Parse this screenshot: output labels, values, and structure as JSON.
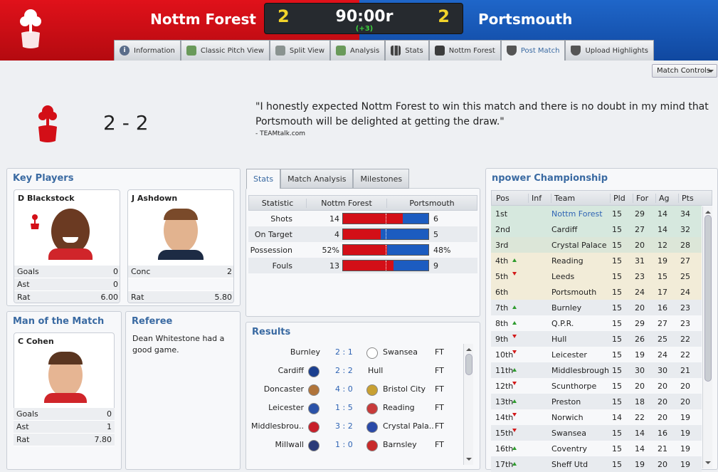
{
  "header": {
    "home_team": "Nottm Forest",
    "away_team": "Portsmouth",
    "home_score": "2",
    "away_score": "2",
    "clock": "90:00r",
    "added_time": "(+3)",
    "home_color": "#d30f17",
    "away_color": "#1c5cc0"
  },
  "tabs": [
    {
      "label": "Information",
      "icon": "info-icon"
    },
    {
      "label": "Classic Pitch View",
      "icon": "pitch-icon"
    },
    {
      "label": "Split View",
      "icon": "split-view-icon"
    },
    {
      "label": "Analysis",
      "icon": "analysis-icon"
    },
    {
      "label": "Stats",
      "icon": "bar-chart-icon"
    },
    {
      "label": "Nottm Forest",
      "icon": "tactics-board-icon"
    },
    {
      "label": "Post Match",
      "icon": "shield-icon"
    },
    {
      "label": "Upload Highlights",
      "icon": "shield-icon"
    }
  ],
  "active_tab": "Post Match",
  "match_controls_label": "Match Controls",
  "summary": {
    "final_score": "2 - 2",
    "quote": "\"I honestly expected Nottm Forest to win this match and there is no doubt in my mind that Portsmouth will be delighted at getting the draw.\"",
    "source": "- TEAMtalk.com"
  },
  "key_players": {
    "title": "Key Players",
    "players": [
      {
        "name": "D Blackstock",
        "rows": [
          {
            "label": "Goals",
            "value": "0"
          },
          {
            "label": "Ast",
            "value": "0"
          },
          {
            "label": "Rat",
            "value": "6.00"
          }
        ]
      },
      {
        "name": "J Ashdown",
        "rows": [
          {
            "label": "Conc",
            "value": "2"
          },
          {
            "label": "",
            "value": ""
          },
          {
            "label": "Rat",
            "value": "5.80"
          }
        ]
      }
    ]
  },
  "motm": {
    "title": "Man of the Match",
    "name": "C Cohen",
    "rows": [
      {
        "label": "Goals",
        "value": "0"
      },
      {
        "label": "Ast",
        "value": "1"
      },
      {
        "label": "Rat",
        "value": "7.80"
      }
    ]
  },
  "referee": {
    "title": "Referee",
    "text": "Dean Whitestone had a good game."
  },
  "stats": {
    "tabs": [
      "Stats",
      "Match Analysis",
      "Milestones"
    ],
    "headers": [
      "Statistic",
      "Nottm Forest",
      "Portsmouth"
    ],
    "rows": [
      {
        "label": "Shots",
        "home": "14",
        "away": "6",
        "home_share": 0.7
      },
      {
        "label": "On Target",
        "home": "4",
        "away": "5",
        "home_share": 0.44
      },
      {
        "label": "Possession",
        "home": "52%",
        "away": "48%",
        "home_share": 0.52
      },
      {
        "label": "Fouls",
        "home": "13",
        "away": "9",
        "home_share": 0.59
      }
    ]
  },
  "results": {
    "title": "Results",
    "rows": [
      {
        "home": "Burnley",
        "score": "2 : 1",
        "away": "Swansea",
        "status": "FT"
      },
      {
        "home": "Cardiff",
        "score": "2 : 2",
        "away": "Hull",
        "status": "FT"
      },
      {
        "home": "Doncaster",
        "score": "4 : 0",
        "away": "Bristol City",
        "status": "FT"
      },
      {
        "home": "Leicester",
        "score": "1 : 5",
        "away": "Reading",
        "status": "FT"
      },
      {
        "home": "Middlesbrou..",
        "score": "3 : 2",
        "away": "Crystal Pala..",
        "status": "FT"
      },
      {
        "home": "Millwall",
        "score": "1 : 0",
        "away": "Barnsley",
        "status": "FT"
      }
    ]
  },
  "league": {
    "title": "npower Championship",
    "headers": [
      "Pos",
      "Inf",
      "Team",
      "Pld",
      "For",
      "Ag",
      "Pts"
    ],
    "rows": [
      {
        "pos": "1st",
        "trend": "",
        "team": "Nottm Forest",
        "pld": "15",
        "for": "29",
        "ag": "14",
        "pts": "34"
      },
      {
        "pos": "2nd",
        "trend": "",
        "team": "Cardiff",
        "pld": "15",
        "for": "27",
        "ag": "14",
        "pts": "32"
      },
      {
        "pos": "3rd",
        "trend": "",
        "team": "Crystal Palace",
        "pld": "15",
        "for": "20",
        "ag": "12",
        "pts": "28"
      },
      {
        "pos": "4th",
        "trend": "up",
        "team": "Reading",
        "pld": "15",
        "for": "31",
        "ag": "19",
        "pts": "27"
      },
      {
        "pos": "5th",
        "trend": "down",
        "team": "Leeds",
        "pld": "15",
        "for": "23",
        "ag": "15",
        "pts": "25"
      },
      {
        "pos": "6th",
        "trend": "",
        "team": "Portsmouth",
        "pld": "15",
        "for": "24",
        "ag": "17",
        "pts": "24"
      },
      {
        "pos": "7th",
        "trend": "up",
        "team": "Burnley",
        "pld": "15",
        "for": "20",
        "ag": "16",
        "pts": "23"
      },
      {
        "pos": "8th",
        "trend": "up",
        "team": "Q.P.R.",
        "pld": "15",
        "for": "29",
        "ag": "27",
        "pts": "23"
      },
      {
        "pos": "9th",
        "trend": "down",
        "team": "Hull",
        "pld": "15",
        "for": "26",
        "ag": "25",
        "pts": "22"
      },
      {
        "pos": "10th",
        "trend": "down",
        "team": "Leicester",
        "pld": "15",
        "for": "19",
        "ag": "24",
        "pts": "22"
      },
      {
        "pos": "11th",
        "trend": "up",
        "team": "Middlesbrough",
        "pld": "15",
        "for": "30",
        "ag": "30",
        "pts": "21"
      },
      {
        "pos": "12th",
        "trend": "down",
        "team": "Scunthorpe",
        "pld": "15",
        "for": "20",
        "ag": "20",
        "pts": "20"
      },
      {
        "pos": "13th",
        "trend": "up",
        "team": "Preston",
        "pld": "15",
        "for": "18",
        "ag": "20",
        "pts": "20"
      },
      {
        "pos": "14th",
        "trend": "down",
        "team": "Norwich",
        "pld": "14",
        "for": "22",
        "ag": "20",
        "pts": "19"
      },
      {
        "pos": "15th",
        "trend": "down",
        "team": "Swansea",
        "pld": "15",
        "for": "14",
        "ag": "16",
        "pts": "19"
      },
      {
        "pos": "16th",
        "trend": "up",
        "team": "Coventry",
        "pld": "15",
        "for": "14",
        "ag": "21",
        "pts": "19"
      },
      {
        "pos": "17th",
        "trend": "up",
        "team": "Sheff Utd",
        "pld": "15",
        "for": "19",
        "ag": "20",
        "pts": "19"
      }
    ]
  }
}
